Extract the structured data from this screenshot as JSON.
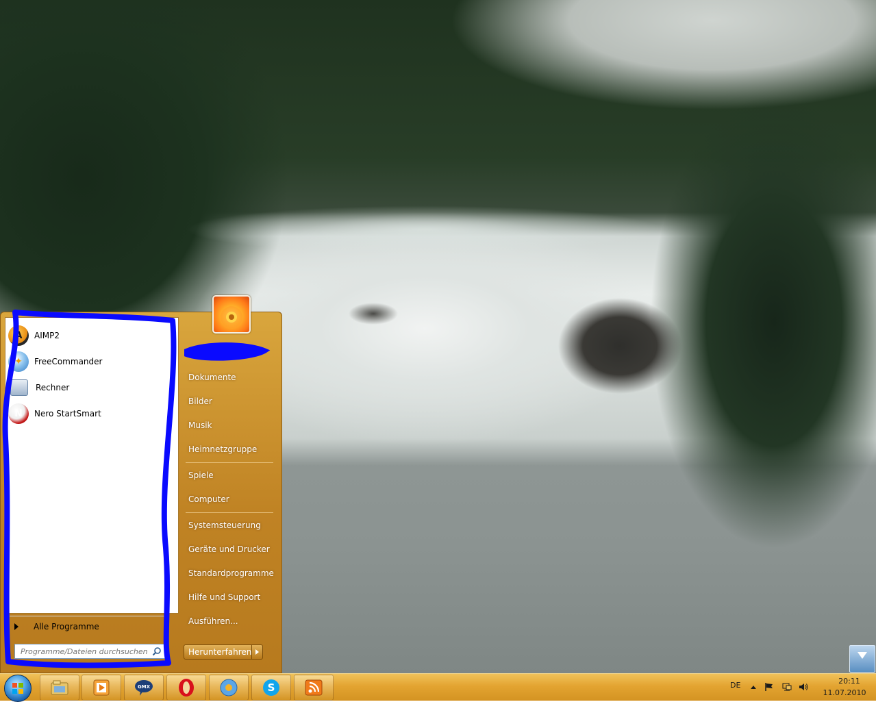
{
  "start_menu": {
    "programs": [
      {
        "label": "AIMP2",
        "icon": "aimp-icon"
      },
      {
        "label": "FreeCommander",
        "icon": "freecommander-icon"
      },
      {
        "label": "Rechner",
        "icon": "calculator-icon"
      },
      {
        "label": "Nero StartSmart",
        "icon": "nero-icon"
      }
    ],
    "all_programs_label": "Alle Programme",
    "search_placeholder": "Programme/Dateien durchsuchen",
    "right_items": [
      "Dokumente",
      "Bilder",
      "Musik",
      "Heimnetzgruppe",
      "Spiele",
      "Computer",
      "Systemsteuerung",
      "Geräte und Drucker",
      "Standardprogramme",
      "Hilfe und Support",
      "Ausführen..."
    ],
    "shutdown_label": "Herunterfahren"
  },
  "taskbar": {
    "pinned": [
      "explorer-icon",
      "media-player-icon",
      "gmx-icon",
      "opera-icon",
      "freecommander-icon",
      "skype-icon",
      "feed-reader-icon"
    ],
    "tray": {
      "language": "DE",
      "time": "20:11",
      "date": "11.07.2010"
    }
  },
  "colors": {
    "start_menu_accent": "#c08324",
    "taskbar": "#e3a431",
    "annotation_scribble": "#0a0aff"
  }
}
